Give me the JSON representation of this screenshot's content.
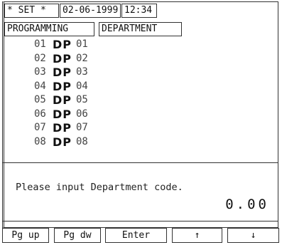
{
  "header": {
    "mode": "* SET *",
    "date": "02-06-1999",
    "time": "12:34",
    "section": "PROGRAMMING",
    "subsection": "DEPARTMENT"
  },
  "departments": [
    {
      "num": "01",
      "prefix": "DP",
      "code": "01"
    },
    {
      "num": "02",
      "prefix": "DP",
      "code": "02"
    },
    {
      "num": "03",
      "prefix": "DP",
      "code": "03"
    },
    {
      "num": "04",
      "prefix": "DP",
      "code": "04"
    },
    {
      "num": "05",
      "prefix": "DP",
      "code": "05"
    },
    {
      "num": "06",
      "prefix": "DP",
      "code": "06"
    },
    {
      "num": "07",
      "prefix": "DP",
      "code": "07"
    },
    {
      "num": "08",
      "prefix": "DP",
      "code": "08"
    }
  ],
  "message": {
    "prompt": "Please input Department code.",
    "amount": "0.00"
  },
  "buttons": {
    "pg_up": "Pg up",
    "pg_dw": "Pg dw",
    "enter": "Enter",
    "up_icon": "↑",
    "down_icon": "↓"
  }
}
